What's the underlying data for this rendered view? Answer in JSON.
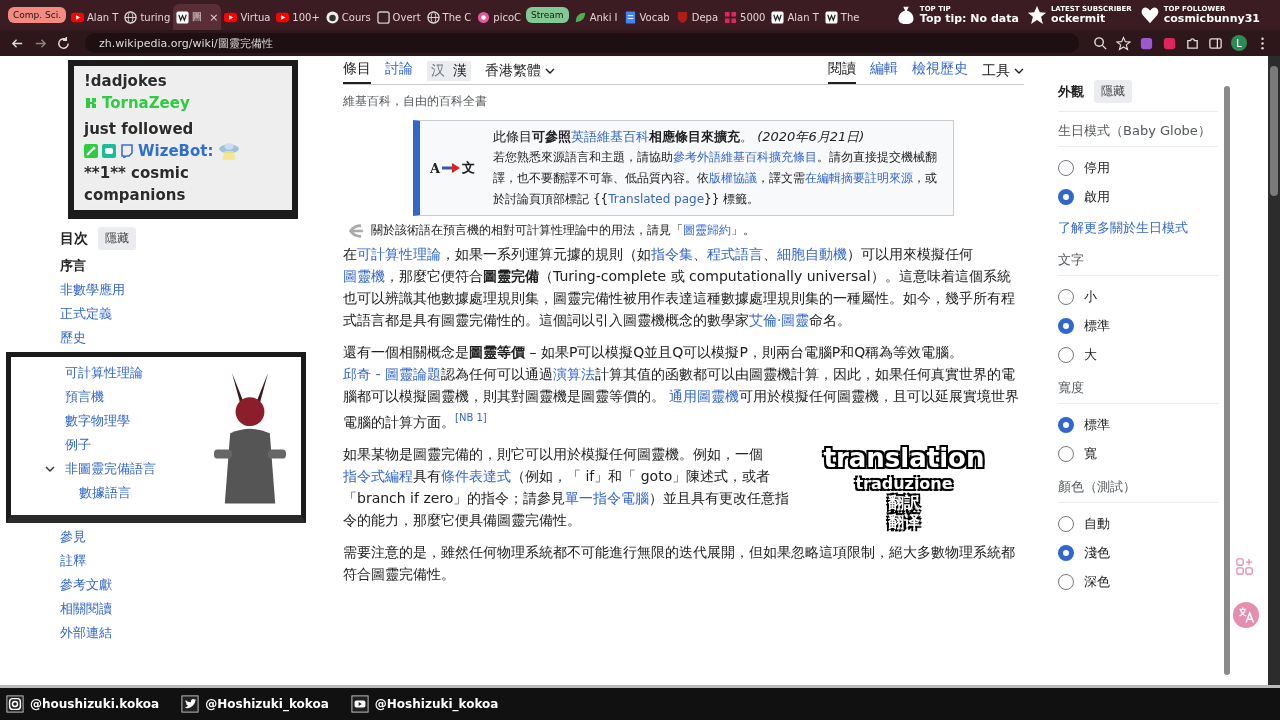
{
  "tab_strip": [
    {
      "kind": "group",
      "title": "Comp. Sci.",
      "color": "#f28b82"
    },
    {
      "kind": "tab",
      "title": "Alan T",
      "selected": false
    },
    {
      "kind": "tab",
      "title": "turing",
      "selected": false
    },
    {
      "kind": "tab",
      "title": "圖",
      "selected": true,
      "close": "×"
    },
    {
      "kind": "tab",
      "title": "Virtua",
      "selected": false
    },
    {
      "kind": "tab",
      "title": "100+",
      "selected": false
    },
    {
      "kind": "tab",
      "title": "Cours",
      "selected": false
    },
    {
      "kind": "tab",
      "title": "Overt",
      "selected": false
    },
    {
      "kind": "tab",
      "title": "The C",
      "selected": false
    },
    {
      "kind": "tab",
      "title": "picoC",
      "selected": false
    },
    {
      "kind": "group",
      "title": "Stream",
      "color": "#81c995"
    },
    {
      "kind": "tab",
      "title": "Anki I",
      "selected": false
    },
    {
      "kind": "tab",
      "title": "Vocab",
      "selected": false
    },
    {
      "kind": "tab",
      "title": "Depa",
      "selected": false
    },
    {
      "kind": "tab",
      "title": "5000",
      "selected": false
    },
    {
      "kind": "tab",
      "title": "Alan T",
      "selected": false
    },
    {
      "kind": "tab",
      "title": "The",
      "selected": false
    }
  ],
  "stream_widgets": [
    {
      "kind": "tip",
      "heading": "TOP TIP",
      "value": "Top tip: No data"
    },
    {
      "kind": "subscriber",
      "heading": "LATEST SUBSCRIBER",
      "value": "ockermit"
    },
    {
      "kind": "follower",
      "heading": "TOP FOLLOWER",
      "value": "cosmicbunny31"
    }
  ],
  "address_bar": {
    "value": "zh.wikipedia.org/wiki/圖靈完備性"
  },
  "profile": {
    "initial": "L"
  },
  "chat": {
    "messages": [
      {
        "kind": "command",
        "text": "!dadjokes"
      },
      {
        "kind": "follow",
        "user": "TornaZeey",
        "text": "just followed"
      },
      {
        "kind": "bot",
        "user": "WizeBot:",
        "text": "**1** cosmic companions"
      }
    ]
  },
  "toc": {
    "title": "目次",
    "toggle": "隱藏",
    "items": [
      {
        "label": "序言",
        "selected": true
      },
      {
        "label": "非數學應用",
        "selected": false
      },
      {
        "label": "正式定義",
        "selected": false
      },
      {
        "label": "歷史",
        "selected": false
      },
      {
        "label": "可計算性理論",
        "selected": false
      },
      {
        "label": "預言機",
        "selected": false
      },
      {
        "label": "數字物理學",
        "selected": false
      },
      {
        "label": "例子",
        "selected": false
      },
      {
        "label": "非圖靈完備語言",
        "selected": false,
        "expanded": true,
        "children": [
          {
            "label": "數據語言",
            "selected": false
          }
        ]
      },
      {
        "label": "參見",
        "selected": false
      },
      {
        "label": "註釋",
        "selected": false
      },
      {
        "label": "參考文獻",
        "selected": false
      },
      {
        "label": "相關閱讀",
        "selected": false
      },
      {
        "label": "外部連結",
        "selected": false
      }
    ]
  },
  "page_tabs": {
    "left": [
      {
        "label": "條目",
        "selected": true
      },
      {
        "label": "討論",
        "selected": false
      }
    ],
    "variants": [
      {
        "label": "汉",
        "selected": false
      },
      {
        "label": "漢",
        "selected": true
      }
    ],
    "language": "香港繁體",
    "right": [
      {
        "label": "閱讀",
        "selected": true,
        "kind": "tab"
      },
      {
        "label": "編輯",
        "selected": false,
        "kind": "tab"
      },
      {
        "label": "檢視歷史",
        "selected": false,
        "kind": "tab"
      },
      {
        "label": "工具",
        "kind": "menu"
      }
    ]
  },
  "tagline": "維基百科，自由的百科全書",
  "notice": {
    "icon_from": "A",
    "icon_to": "文",
    "lines": [
      [
        {
          "kind": "text",
          "t": "此條目"
        },
        {
          "kind": "bold",
          "t": "可參照"
        },
        {
          "kind": "link",
          "t": "英語維基百科"
        },
        {
          "kind": "bold",
          "t": "相應條目來擴充"
        },
        {
          "kind": "text",
          "t": "。 "
        },
        {
          "kind": "italic",
          "t": "(2020年6月21日)"
        }
      ],
      [
        {
          "kind": "text",
          "t": "若您熟悉來源語言和主題，請協助"
        },
        {
          "kind": "link",
          "t": "參考外語維基百科擴充條目"
        },
        {
          "kind": "text",
          "t": "。請勿直接提交機械翻譯，也不要翻譯不可靠、低品質內容。依"
        },
        {
          "kind": "link",
          "t": "版權協議"
        },
        {
          "kind": "text",
          "t": "，譯文需"
        },
        {
          "kind": "link",
          "t": "在編輯摘要註明來源"
        },
        {
          "kind": "text",
          "t": "，或於討論頁頂部標記 {{"
        },
        {
          "kind": "link",
          "t": "Translated page"
        },
        {
          "kind": "text",
          "t": "}} 標籤。"
        }
      ]
    ]
  },
  "hatnote": [
    {
      "kind": "text",
      "t": "關於該術語在預言機的相對可計算性理論中的用法，請見「"
    },
    {
      "kind": "link",
      "t": "圖靈歸約"
    },
    {
      "kind": "text",
      "t": "」。"
    }
  ],
  "paragraphs": [
    [
      {
        "kind": "text",
        "t": "在"
      },
      {
        "kind": "link",
        "t": "可計算性理論"
      },
      {
        "kind": "text",
        "t": "，如果一系列運算元據的規則（如"
      },
      {
        "kind": "link",
        "t": "指令集"
      },
      {
        "kind": "text",
        "t": "、"
      },
      {
        "kind": "link",
        "t": "程式語言"
      },
      {
        "kind": "text",
        "t": "、"
      },
      {
        "kind": "link",
        "t": "細胞自動機"
      },
      {
        "kind": "text",
        "t": "）可以用來模擬任何"
      },
      {
        "kind": "link",
        "t": "圖靈機"
      },
      {
        "kind": "text",
        "t": "，那麼它便符合"
      },
      {
        "kind": "bold",
        "t": "圖靈完備"
      },
      {
        "kind": "text",
        "t": "（Turing-complete 或 computationally universal）。這意味着這個系統也可以辨識其他數據處理規則集，圖靈完備性被用作表達這種數據處理規則集的一種屬性。如今，幾乎所有程式語言都是具有圖靈完備性的。這個詞以引入圖靈機概念的數學家"
      },
      {
        "kind": "link",
        "t": "艾倫·圖靈"
      },
      {
        "kind": "text",
        "t": "命名。"
      }
    ],
    [
      {
        "kind": "text",
        "t": "還有一個相關概念是"
      },
      {
        "kind": "bold",
        "t": "圖靈等價"
      },
      {
        "kind": "text",
        "t": " – 如果P可以模擬Q並且Q可以模擬P，則兩台電腦P和Q稱為等效電腦。"
      },
      {
        "kind": "link",
        "t": "邱奇 - 圖靈論題"
      },
      {
        "kind": "text",
        "t": "認為任何可以通過"
      },
      {
        "kind": "link",
        "t": "演算法"
      },
      {
        "kind": "text",
        "t": "計算其值的函數都可以由圖靈機計算，因此，如果任何真實世界的電腦都可以模擬圖靈機，則其對圖靈機是圖靈等價的。 "
      },
      {
        "kind": "link",
        "t": "通用圖靈機"
      },
      {
        "kind": "text",
        "t": "可用於模擬任何圖靈機，且可以延展實境世界電腦的計算方面。"
      },
      {
        "kind": "ref",
        "t": "[NB 1]"
      }
    ],
    [
      {
        "kind": "text",
        "t": "如果某物是圖靈完備的，則它可以用於模擬任何圖靈機。例如，一個"
      },
      {
        "kind": "link",
        "t": "指令式編程"
      },
      {
        "kind": "text",
        "t": "具有"
      },
      {
        "kind": "link",
        "t": "條件表達式"
      },
      {
        "kind": "text",
        "t": "（例如，「 if」和「 goto」陳述式，或者「branch if zero」的指令；請參見"
      },
      {
        "kind": "link",
        "t": "單一指令電腦"
      },
      {
        "kind": "text",
        "t": "）並且具有更改任意指令的能力，那麼它便具備圖靈完備性。"
      }
    ],
    [
      {
        "kind": "text",
        "t": "需要注意的是，雖然任何物理系統都不可能進行無限的迭代展開，但如果忽略這項限制，絕大多數物理系統都符合圖靈完備性。"
      }
    ]
  ],
  "subtitles": [
    "translation",
    "traduzione",
    "翻訳",
    "翻译"
  ],
  "appearance": {
    "title": "外觀",
    "hide_button": "隱藏",
    "sections": [
      {
        "title": "生日模式（Baby Globe）",
        "options": [
          {
            "label": "停用",
            "selected": false
          },
          {
            "label": "啟用",
            "selected": true
          }
        ],
        "link": "了解更多關於生日模式"
      },
      {
        "title": "文字",
        "options": [
          {
            "label": "小",
            "selected": false
          },
          {
            "label": "標準",
            "selected": true
          },
          {
            "label": "大",
            "selected": false
          }
        ]
      },
      {
        "title": "寬度",
        "options": [
          {
            "label": "標準",
            "selected": true
          },
          {
            "label": "寬",
            "selected": false
          }
        ]
      },
      {
        "title": "顏色（測試）",
        "options": [
          {
            "label": "自動",
            "selected": false
          },
          {
            "label": "淺色",
            "selected": true
          },
          {
            "label": "深色",
            "selected": false
          }
        ]
      }
    ]
  },
  "socials": [
    {
      "kind": "instagram",
      "handle": "@houshizuki.kokoa"
    },
    {
      "kind": "twitter",
      "handle": "@Hoshizuki_kokoa"
    },
    {
      "kind": "youtube",
      "handle": "@Hoshizuki_kokoa"
    }
  ]
}
